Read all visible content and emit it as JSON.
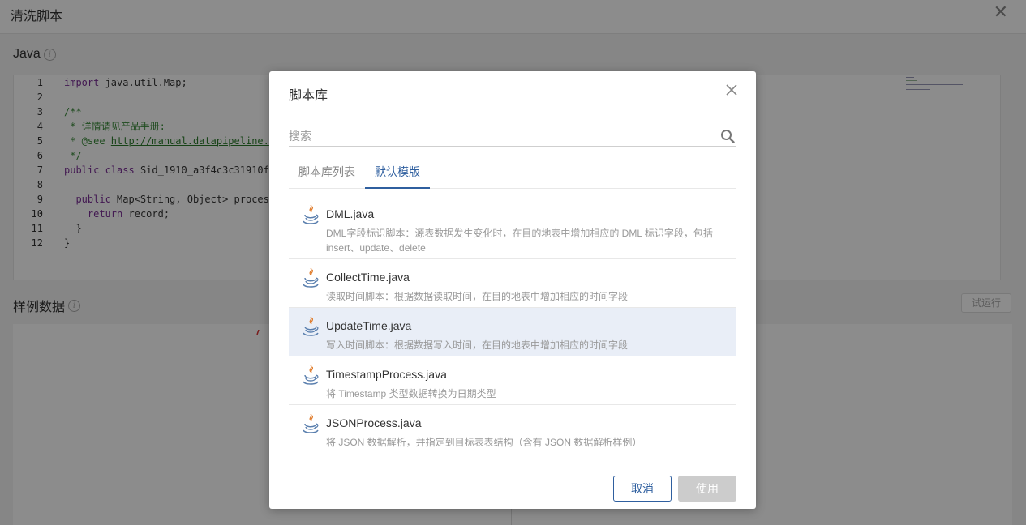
{
  "page": {
    "title": "清洗脚本",
    "close_glyph": "✕",
    "java_section": "Java",
    "sample_section": "样例数据",
    "trial_run": "试运行",
    "info_glyph": "i",
    "code_lines": [
      {
        "num": "1",
        "tokens": [
          {
            "t": "import",
            "c": "kw"
          },
          {
            "t": " java.util.Map;",
            "c": ""
          }
        ]
      },
      {
        "num": "2",
        "tokens": []
      },
      {
        "num": "3",
        "tokens": [
          {
            "t": "/**",
            "c": "cm"
          }
        ]
      },
      {
        "num": "4",
        "tokens": [
          {
            "t": " * 详情请见产品手册:",
            "c": "cm"
          }
        ]
      },
      {
        "num": "5",
        "tokens": [
          {
            "t": " * @see ",
            "c": "cm"
          },
          {
            "t": "http://manual.datapipeline.",
            "c": "lnk"
          }
        ]
      },
      {
        "num": "6",
        "tokens": [
          {
            "t": " */",
            "c": "cm"
          }
        ]
      },
      {
        "num": "7",
        "tokens": [
          {
            "t": "public",
            "c": "kw"
          },
          {
            "t": " ",
            "c": ""
          },
          {
            "t": "class",
            "c": "kw"
          },
          {
            "t": " Sid_1910_a3f4c3c31910f",
            "c": ""
          }
        ]
      },
      {
        "num": "8",
        "tokens": []
      },
      {
        "num": "9",
        "tokens": [
          {
            "t": "  ",
            "c": ""
          },
          {
            "t": "public",
            "c": "kw"
          },
          {
            "t": " Map<String, Object> proces",
            "c": ""
          }
        ]
      },
      {
        "num": "10",
        "tokens": [
          {
            "t": "    ",
            "c": ""
          },
          {
            "t": "return",
            "c": "kw"
          },
          {
            "t": " record;",
            "c": ""
          }
        ]
      },
      {
        "num": "11",
        "tokens": [
          {
            "t": "  }",
            "c": ""
          }
        ]
      },
      {
        "num": "12",
        "tokens": [
          {
            "t": "}",
            "c": ""
          }
        ]
      }
    ]
  },
  "modal": {
    "title": "脚本库",
    "search": {
      "placeholder": "搜索",
      "value": ""
    },
    "tabs": [
      {
        "label": "脚本库列表",
        "active": false
      },
      {
        "label": "默认模版",
        "active": true
      }
    ],
    "items": [
      {
        "name": "DML.java",
        "desc": "DML字段标识脚本：源表数据发生变化时，在目的地表中增加相应的 DML 标识字段，包括 insert、update、delete",
        "selected": false
      },
      {
        "name": "CollectTime.java",
        "desc": "读取时间脚本：根据数据读取时间，在目的地表中增加相应的时间字段",
        "selected": false
      },
      {
        "name": "UpdateTime.java",
        "desc": "写入时间脚本：根据数据写入时间，在目的地表中增加相应的时间字段",
        "selected": true
      },
      {
        "name": "TimestampProcess.java",
        "desc": "将 Timestamp 类型数据转换为日期类型",
        "selected": false
      },
      {
        "name": "JSONProcess.java",
        "desc": "将 JSON 数据解析，并指定到目标表表结构（含有 JSON 数据解析样例）",
        "selected": false
      }
    ],
    "cancel_label": "取消",
    "use_label": "使用"
  },
  "colors": {
    "accent": "#2f5f9f",
    "selected_row": "#e9eef7",
    "disabled_button": "#cccccc",
    "overlay": "rgba(0,0,0,0.45)"
  },
  "icons": {
    "modal_close": "close-icon",
    "search": "search-icon",
    "item": "java-icon",
    "info": "info-icon"
  }
}
